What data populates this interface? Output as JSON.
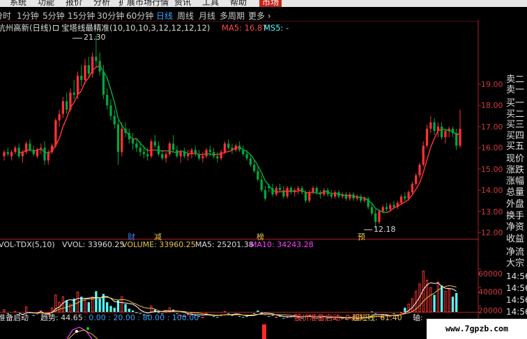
{
  "menu": {
    "items": [
      "系统",
      "功能",
      "报价",
      "分析",
      "扩展市场行情",
      "资讯",
      "工具",
      "帮助"
    ],
    "market_label": "市场"
  },
  "periods": {
    "items": [
      "分时",
      "1分钟",
      "5分钟",
      "15分钟",
      "30分钟",
      "60分钟",
      "日线",
      "周线",
      "月线",
      "多周期",
      "更多 ›"
    ],
    "active": "日线"
  },
  "main_info": {
    "stock_title": "杭州高新(日线)",
    "indicator": "宝塔线最精准(10,10,10,3,12,12,12,12)",
    "ma5": "MA5: 16.87",
    "ms5": "MS5: -"
  },
  "price_axis": {
    "ticks": [
      "19.00",
      "18.00",
      "17.00",
      "16.00",
      "15.00",
      "14.00",
      "13.00",
      "12.00"
    ]
  },
  "annotations": {
    "high_label": "21.30",
    "low_label": "12.18",
    "markers": [
      {
        "text": "财",
        "color": "#3b7fff"
      },
      {
        "text": "减",
        "color": "#e5c44a"
      },
      {
        "text": "榜",
        "color": "#e5c44a"
      },
      {
        "text": "预",
        "color": "#e5c44a"
      }
    ]
  },
  "right_panel": {
    "labels": [
      "卖二",
      "卖一",
      "买一",
      "买二",
      "买三",
      "买四",
      "买五",
      "现价",
      "涨跌",
      "涨幅",
      "总量",
      "外盘",
      "换手",
      "净资",
      "收益"
    ],
    "lower_labels": [
      "净流",
      "大宗",
      "14:56",
      "14:56",
      "14:56",
      "14:56"
    ]
  },
  "volume_info": {
    "name": "VOL-TDX(5,10)",
    "vvol": "VVOL: 33960.25",
    "volume": "VOLUME: 33960.25",
    "ma5": "MA5: 25201.38",
    "ma10": "MA10: 34243.28"
  },
  "volume_axis": {
    "ticks": [
      "60000",
      "40000",
      "20000"
    ]
  },
  "bottom_info": {
    "name": "准备启动",
    "trend": "趋势: 44.65",
    "levels": ": 0.00 : 20.00 : 80.00 : 100.00",
    "signal": "股价准备启动: 0.00",
    "overbought": "超短线: 61.40",
    "tail": "轴:"
  },
  "watermark": "www.7gpzb.com",
  "colors": {
    "up": "#ff3232",
    "down": "#00a83a",
    "cyan": "#54ffff",
    "magenta": "#ff3dff",
    "yellow": "#e5c44a",
    "axis_red": "#b02020"
  },
  "chart_data": {
    "type": "candlestick",
    "price_ylim": [
      12.0,
      19.0
    ],
    "candles": [
      {
        "o": 15.6,
        "h": 15.9,
        "l": 15.4,
        "c": 15.8
      },
      {
        "o": 15.8,
        "h": 16.0,
        "l": 15.6,
        "c": 15.7
      },
      {
        "o": 15.6,
        "h": 15.9,
        "l": 15.4,
        "c": 15.8
      },
      {
        "o": 15.8,
        "h": 16.1,
        "l": 15.7,
        "c": 16.0
      },
      {
        "o": 16.0,
        "h": 16.2,
        "l": 15.5,
        "c": 15.6
      },
      {
        "o": 15.6,
        "h": 15.9,
        "l": 15.3,
        "c": 15.8
      },
      {
        "o": 15.8,
        "h": 16.3,
        "l": 15.7,
        "c": 16.2
      },
      {
        "o": 16.2,
        "h": 16.4,
        "l": 15.8,
        "c": 15.9
      },
      {
        "o": 15.9,
        "h": 16.1,
        "l": 15.6,
        "c": 15.7
      },
      {
        "o": 15.6,
        "h": 16.0,
        "l": 15.5,
        "c": 15.9
      },
      {
        "o": 15.9,
        "h": 16.2,
        "l": 15.7,
        "c": 16.0
      },
      {
        "o": 16.0,
        "h": 16.3,
        "l": 15.2,
        "c": 15.4
      },
      {
        "o": 15.4,
        "h": 15.9,
        "l": 15.2,
        "c": 15.8
      },
      {
        "o": 15.8,
        "h": 16.2,
        "l": 15.7,
        "c": 16.1
      },
      {
        "o": 16.1,
        "h": 17.4,
        "l": 16.0,
        "c": 17.3
      },
      {
        "o": 17.3,
        "h": 17.8,
        "l": 17.0,
        "c": 17.6
      },
      {
        "o": 17.6,
        "h": 18.4,
        "l": 17.4,
        "c": 18.2
      },
      {
        "o": 18.2,
        "h": 18.6,
        "l": 17.6,
        "c": 17.8
      },
      {
        "o": 17.8,
        "h": 18.8,
        "l": 17.7,
        "c": 18.6
      },
      {
        "o": 18.6,
        "h": 19.2,
        "l": 18.3,
        "c": 18.5
      },
      {
        "o": 18.5,
        "h": 19.6,
        "l": 18.3,
        "c": 19.4
      },
      {
        "o": 19.4,
        "h": 19.9,
        "l": 18.9,
        "c": 19.2
      },
      {
        "o": 19.2,
        "h": 20.2,
        "l": 19.0,
        "c": 19.9
      },
      {
        "o": 19.9,
        "h": 20.3,
        "l": 19.3,
        "c": 19.5
      },
      {
        "o": 19.5,
        "h": 20.5,
        "l": 19.3,
        "c": 20.3
      },
      {
        "o": 20.3,
        "h": 21.3,
        "l": 19.8,
        "c": 20.1
      },
      {
        "o": 20.1,
        "h": 20.5,
        "l": 19.4,
        "c": 19.6
      },
      {
        "o": 19.6,
        "h": 19.9,
        "l": 18.3,
        "c": 18.5
      },
      {
        "o": 18.5,
        "h": 18.8,
        "l": 17.8,
        "c": 18.0
      },
      {
        "o": 18.0,
        "h": 18.3,
        "l": 17.3,
        "c": 17.5
      },
      {
        "o": 17.5,
        "h": 17.8,
        "l": 16.9,
        "c": 17.1
      },
      {
        "o": 17.1,
        "h": 17.3,
        "l": 15.2,
        "c": 15.8
      },
      {
        "o": 15.8,
        "h": 17.2,
        "l": 15.6,
        "c": 16.9
      },
      {
        "o": 16.9,
        "h": 17.2,
        "l": 16.5,
        "c": 16.7
      },
      {
        "o": 16.7,
        "h": 16.9,
        "l": 16.2,
        "c": 16.4
      },
      {
        "o": 16.4,
        "h": 16.7,
        "l": 15.9,
        "c": 16.2
      },
      {
        "o": 16.2,
        "h": 16.4,
        "l": 15.8,
        "c": 16.0
      },
      {
        "o": 16.0,
        "h": 16.3,
        "l": 15.6,
        "c": 15.8
      },
      {
        "o": 15.8,
        "h": 16.1,
        "l": 15.5,
        "c": 15.7
      },
      {
        "o": 15.7,
        "h": 16.0,
        "l": 15.4,
        "c": 15.6
      },
      {
        "o": 15.6,
        "h": 16.4,
        "l": 15.5,
        "c": 16.3
      },
      {
        "o": 16.3,
        "h": 16.6,
        "l": 16.0,
        "c": 16.1
      },
      {
        "o": 16.1,
        "h": 16.3,
        "l": 15.6,
        "c": 15.7
      },
      {
        "o": 15.7,
        "h": 15.9,
        "l": 15.4,
        "c": 15.5
      },
      {
        "o": 15.5,
        "h": 15.8,
        "l": 15.3,
        "c": 15.7
      },
      {
        "o": 15.7,
        "h": 16.3,
        "l": 15.6,
        "c": 16.2
      },
      {
        "o": 16.2,
        "h": 16.6,
        "l": 15.8,
        "c": 15.9
      },
      {
        "o": 15.9,
        "h": 16.1,
        "l": 15.5,
        "c": 15.6
      },
      {
        "o": 15.6,
        "h": 15.9,
        "l": 15.3,
        "c": 15.8
      },
      {
        "o": 15.8,
        "h": 16.0,
        "l": 15.5,
        "c": 15.6
      },
      {
        "o": 15.6,
        "h": 15.9,
        "l": 15.4,
        "c": 15.7
      },
      {
        "o": 15.7,
        "h": 16.0,
        "l": 15.5,
        "c": 15.9
      },
      {
        "o": 15.9,
        "h": 16.1,
        "l": 15.6,
        "c": 15.7
      },
      {
        "o": 15.7,
        "h": 15.9,
        "l": 15.4,
        "c": 15.5
      },
      {
        "o": 15.5,
        "h": 15.8,
        "l": 15.3,
        "c": 15.6
      },
      {
        "o": 15.6,
        "h": 16.0,
        "l": 15.5,
        "c": 15.9
      },
      {
        "o": 15.9,
        "h": 16.1,
        "l": 15.6,
        "c": 15.8
      },
      {
        "o": 15.8,
        "h": 16.0,
        "l": 15.5,
        "c": 15.6
      },
      {
        "o": 15.6,
        "h": 15.8,
        "l": 15.3,
        "c": 15.5
      },
      {
        "o": 15.5,
        "h": 15.9,
        "l": 15.4,
        "c": 15.8
      },
      {
        "o": 15.8,
        "h": 16.3,
        "l": 15.7,
        "c": 16.2
      },
      {
        "o": 16.2,
        "h": 16.4,
        "l": 15.9,
        "c": 16.0
      },
      {
        "o": 16.0,
        "h": 16.2,
        "l": 15.7,
        "c": 15.9
      },
      {
        "o": 15.9,
        "h": 16.2,
        "l": 15.8,
        "c": 16.1
      },
      {
        "o": 16.1,
        "h": 16.3,
        "l": 15.8,
        "c": 15.9
      },
      {
        "o": 15.9,
        "h": 16.1,
        "l": 15.6,
        "c": 15.7
      },
      {
        "o": 15.7,
        "h": 15.9,
        "l": 15.4,
        "c": 15.5
      },
      {
        "o": 15.5,
        "h": 15.7,
        "l": 15.1,
        "c": 15.2
      },
      {
        "o": 15.2,
        "h": 15.4,
        "l": 14.8,
        "c": 14.9
      },
      {
        "o": 14.9,
        "h": 15.1,
        "l": 14.4,
        "c": 14.5
      },
      {
        "o": 14.5,
        "h": 14.7,
        "l": 13.9,
        "c": 14.0
      },
      {
        "o": 14.0,
        "h": 14.2,
        "l": 13.5,
        "c": 13.6
      },
      {
        "o": 14.2,
        "h": 14.3,
        "l": 13.9,
        "c": 14.1
      },
      {
        "o": 14.1,
        "h": 14.3,
        "l": 13.7,
        "c": 13.8
      },
      {
        "o": 13.8,
        "h": 14.2,
        "l": 13.7,
        "c": 14.1
      },
      {
        "o": 14.1,
        "h": 14.3,
        "l": 13.9,
        "c": 14.0
      },
      {
        "o": 14.0,
        "h": 14.2,
        "l": 13.6,
        "c": 13.7
      },
      {
        "o": 13.7,
        "h": 14.2,
        "l": 13.6,
        "c": 14.1
      },
      {
        "o": 14.1,
        "h": 14.2,
        "l": 13.8,
        "c": 13.9
      },
      {
        "o": 13.9,
        "h": 14.1,
        "l": 13.7,
        "c": 14.0
      },
      {
        "o": 14.0,
        "h": 14.2,
        "l": 13.8,
        "c": 14.1
      },
      {
        "o": 14.1,
        "h": 14.2,
        "l": 13.8,
        "c": 13.9
      },
      {
        "o": 13.9,
        "h": 14.0,
        "l": 13.4,
        "c": 13.5
      },
      {
        "o": 13.5,
        "h": 14.0,
        "l": 13.4,
        "c": 13.9
      },
      {
        "o": 13.9,
        "h": 14.2,
        "l": 13.8,
        "c": 14.1
      },
      {
        "o": 14.1,
        "h": 14.2,
        "l": 13.8,
        "c": 13.9
      },
      {
        "o": 13.9,
        "h": 14.0,
        "l": 13.6,
        "c": 13.8
      },
      {
        "o": 13.8,
        "h": 14.1,
        "l": 13.7,
        "c": 14.0
      },
      {
        "o": 14.0,
        "h": 14.1,
        "l": 13.7,
        "c": 13.8
      },
      {
        "o": 13.8,
        "h": 14.0,
        "l": 13.6,
        "c": 13.7
      },
      {
        "o": 13.7,
        "h": 14.0,
        "l": 13.6,
        "c": 13.9
      },
      {
        "o": 13.9,
        "h": 14.0,
        "l": 13.6,
        "c": 13.7
      },
      {
        "o": 13.7,
        "h": 13.9,
        "l": 13.6,
        "c": 13.8
      },
      {
        "o": 13.8,
        "h": 13.9,
        "l": 13.5,
        "c": 13.6
      },
      {
        "o": 13.6,
        "h": 13.9,
        "l": 13.5,
        "c": 13.8
      },
      {
        "o": 13.8,
        "h": 13.9,
        "l": 13.5,
        "c": 13.6
      },
      {
        "o": 13.6,
        "h": 13.8,
        "l": 13.5,
        "c": 13.7
      },
      {
        "o": 13.7,
        "h": 13.8,
        "l": 13.4,
        "c": 13.5
      },
      {
        "o": 13.5,
        "h": 13.7,
        "l": 13.4,
        "c": 13.6
      },
      {
        "o": 13.6,
        "h": 13.7,
        "l": 13.1,
        "c": 13.2
      },
      {
        "o": 13.2,
        "h": 13.4,
        "l": 12.8,
        "c": 12.9
      },
      {
        "o": 12.9,
        "h": 13.1,
        "l": 12.2,
        "c": 12.5
      },
      {
        "o": 12.5,
        "h": 13.1,
        "l": 12.4,
        "c": 13.0
      },
      {
        "o": 13.0,
        "h": 13.3,
        "l": 12.9,
        "c": 13.2
      },
      {
        "o": 13.2,
        "h": 13.4,
        "l": 13.0,
        "c": 13.1
      },
      {
        "o": 13.1,
        "h": 13.4,
        "l": 13.0,
        "c": 13.3
      },
      {
        "o": 13.3,
        "h": 13.5,
        "l": 13.1,
        "c": 13.2
      },
      {
        "o": 13.2,
        "h": 13.5,
        "l": 13.1,
        "c": 13.4
      },
      {
        "o": 13.4,
        "h": 13.8,
        "l": 13.3,
        "c": 13.7
      },
      {
        "o": 13.7,
        "h": 13.9,
        "l": 13.5,
        "c": 13.6
      },
      {
        "o": 13.6,
        "h": 14.0,
        "l": 13.5,
        "c": 13.9
      },
      {
        "o": 13.9,
        "h": 14.4,
        "l": 13.8,
        "c": 14.3
      },
      {
        "o": 14.3,
        "h": 14.8,
        "l": 14.2,
        "c": 14.7
      },
      {
        "o": 14.7,
        "h": 15.3,
        "l": 14.6,
        "c": 15.2
      },
      {
        "o": 15.2,
        "h": 16.3,
        "l": 15.1,
        "c": 16.1
      },
      {
        "o": 16.1,
        "h": 17.1,
        "l": 16.0,
        "c": 16.9
      },
      {
        "o": 16.9,
        "h": 17.5,
        "l": 16.7,
        "c": 17.2
      },
      {
        "o": 17.2,
        "h": 17.4,
        "l": 16.6,
        "c": 16.8
      },
      {
        "o": 16.8,
        "h": 17.2,
        "l": 16.5,
        "c": 17.0
      },
      {
        "o": 17.0,
        "h": 17.2,
        "l": 16.4,
        "c": 16.5
      },
      {
        "o": 16.5,
        "h": 16.9,
        "l": 16.2,
        "c": 16.8
      },
      {
        "o": 16.8,
        "h": 17.0,
        "l": 16.5,
        "c": 16.9
      },
      {
        "o": 16.9,
        "h": 17.0,
        "l": 16.5,
        "c": 16.7
      },
      {
        "o": 16.7,
        "h": 16.9,
        "l": 15.9,
        "c": 16.1
      },
      {
        "o": 16.1,
        "h": 17.8,
        "l": 16.0,
        "c": 16.9
      }
    ],
    "volume_ylim": [
      0,
      70000
    ],
    "volumes": [
      16000,
      12000,
      9000,
      14000,
      11000,
      8000,
      19000,
      13000,
      10000,
      12000,
      15000,
      9000,
      11000,
      18000,
      32000,
      24000,
      30000,
      26000,
      22000,
      28000,
      35000,
      30000,
      26000,
      24000,
      30000,
      36000,
      28000,
      33000,
      24000,
      20000,
      18000,
      26000,
      30000,
      22000,
      17000,
      15000,
      13000,
      12000,
      11000,
      10000,
      20000,
      16000,
      13000,
      12000,
      14000,
      18000,
      16000,
      12000,
      10000,
      9000,
      11000,
      13000,
      10000,
      9000,
      8000,
      12000,
      11000,
      9000,
      8000,
      10000,
      14000,
      12000,
      10000,
      11000,
      9000,
      8000,
      9000,
      10000,
      12000,
      15000,
      13000,
      11000,
      9000,
      10000,
      8000,
      9000,
      7000,
      8000,
      9000,
      10000,
      8000,
      7000,
      9000,
      10000,
      8000,
      7000,
      8000,
      9000,
      7000,
      8000,
      6000,
      8000,
      7000,
      6000,
      8000,
      7000,
      6000,
      7000,
      8000,
      11000,
      14000,
      12000,
      9000,
      8000,
      10000,
      9000,
      12000,
      10000,
      13000,
      18000,
      22000,
      28000,
      36000,
      44000,
      58000,
      48000,
      40000,
      32000,
      46000,
      42000,
      36000,
      38000,
      30000,
      34000
    ],
    "ma_series": [
      {
        "name": "MA5",
        "color": "#ffffff"
      },
      {
        "name": "MA10",
        "color": "#e5c44a"
      }
    ]
  }
}
